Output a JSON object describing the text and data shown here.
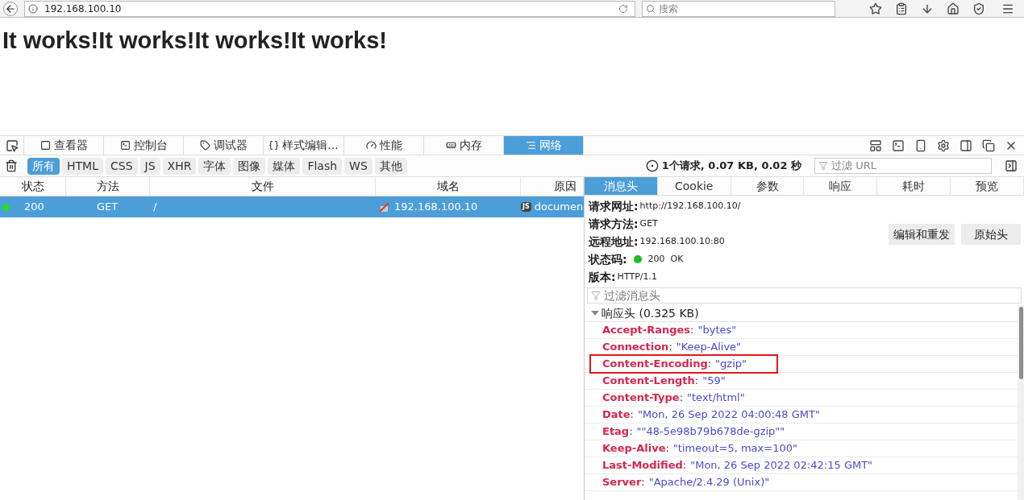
{
  "browser": {
    "url": "192.168.100.10",
    "search_placeholder": "搜索"
  },
  "page": {
    "heading": "It works!It works!It works!It works!"
  },
  "devtools": {
    "tabs": [
      {
        "label": "查看器",
        "selected": false
      },
      {
        "label": "控制台",
        "selected": false
      },
      {
        "label": "调试器",
        "selected": false
      },
      {
        "label": "样式编辑...",
        "selected": false
      },
      {
        "label": "性能",
        "selected": false
      },
      {
        "label": "内存",
        "selected": false
      },
      {
        "label": "网络",
        "selected": true
      }
    ],
    "filters": [
      {
        "label": "所有",
        "selected": true
      },
      {
        "label": "HTML",
        "selected": false
      },
      {
        "label": "CSS",
        "selected": false
      },
      {
        "label": "JS",
        "selected": false
      },
      {
        "label": "XHR",
        "selected": false
      },
      {
        "label": "字体",
        "selected": false
      },
      {
        "label": "图像",
        "selected": false
      },
      {
        "label": "媒体",
        "selected": false
      },
      {
        "label": "Flash",
        "selected": false
      },
      {
        "label": "WS",
        "selected": false
      },
      {
        "label": "其他",
        "selected": false
      }
    ],
    "summary": "1个请求, 0.07 KB, 0.02 秒",
    "url_filter_placeholder": "过滤 URL",
    "table": {
      "columns": [
        "状态",
        "方法",
        "文件",
        "域名",
        "原因"
      ],
      "rows": [
        {
          "color": "#22dd22",
          "status": "200",
          "method": "GET",
          "file": "/",
          "domain": "192.168.100.10",
          "cause_badge": "JS",
          "cause": "documen",
          "selected": true
        }
      ]
    },
    "detail_tabs": [
      {
        "label": "消息头",
        "selected": true
      },
      {
        "label": "Cookie",
        "selected": false
      },
      {
        "label": "参数",
        "selected": false
      },
      {
        "label": "响应",
        "selected": false
      },
      {
        "label": "耗时",
        "selected": false
      },
      {
        "label": "预览",
        "selected": false
      }
    ],
    "summary_fields": [
      {
        "label": "请求网址:",
        "value": "http://192.168.100.10/"
      },
      {
        "label": "请求方法:",
        "value": "GET"
      },
      {
        "label": "远程地址:",
        "value": "192.168.100.10:80"
      },
      {
        "label": "状态码:",
        "value": "200  OK",
        "color": "#22bb22"
      },
      {
        "label": "版本:",
        "value": "HTTP/1.1"
      }
    ],
    "buttons": [
      "编辑和重发",
      "原始头"
    ],
    "header_filter_placeholder": "过滤消息头",
    "response_headers": {
      "title": "响应头 (0.325 KB)",
      "expanded": true,
      "items": [
        {
          "name": "Accept-Ranges",
          "separator": ":",
          "value": "\"bytes\"",
          "highlighted": false
        },
        {
          "name": "Connection",
          "separator": ":",
          "value": "\"Keep-Alive\"",
          "highlighted": false
        },
        {
          "name": "Content-Encoding",
          "separator": ":",
          "value": "\"gzip\"",
          "highlighted": true
        },
        {
          "name": "Content-Length",
          "separator": ":",
          "value": "\"59\"",
          "highlighted": false
        },
        {
          "name": "Content-Type",
          "separator": ":",
          "value": "\"text/html\"",
          "highlighted": false
        },
        {
          "name": "Date",
          "separator": ":",
          "value": "\"Mon, 26 Sep 2022 04:00:48 GMT\"",
          "highlighted": false
        },
        {
          "name": "Etag",
          "separator": ":",
          "value": "\"\"48-5e98b79b678de-gzip\"\"",
          "highlighted": false
        },
        {
          "name": "Keep-Alive",
          "separator": ":",
          "value": "\"timeout=5, max=100\"",
          "highlighted": false
        },
        {
          "name": "Last-Modified",
          "separator": ":",
          "value": "\"Mon, 26 Sep 2022 02:42:15 GMT\"",
          "highlighted": false
        },
        {
          "name": "Server",
          "separator": ":",
          "value": "\"Apache/2.4.29 (Unix)\"",
          "highlighted": false
        }
      ]
    }
  }
}
